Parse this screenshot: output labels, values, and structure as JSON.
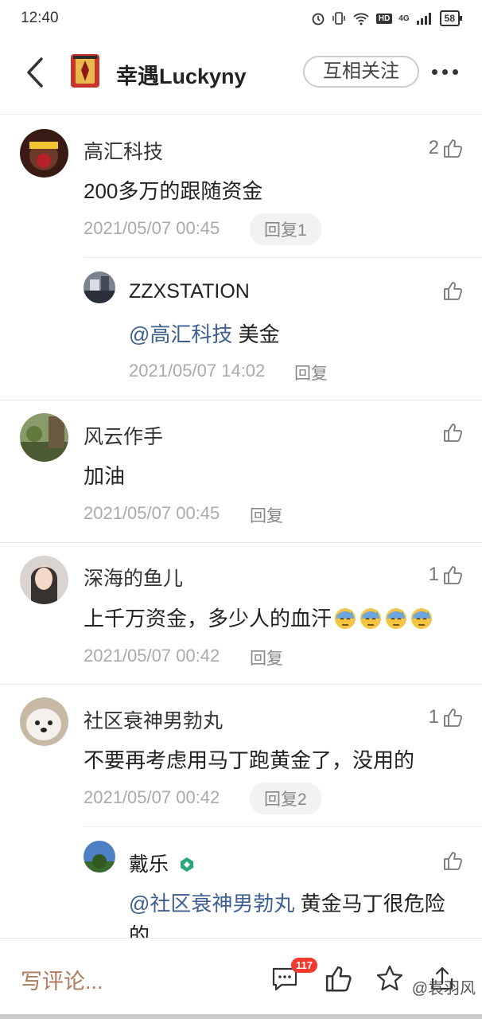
{
  "status_bar": {
    "time": "12:40",
    "network": "4G",
    "hd": "HD",
    "battery": "58"
  },
  "header": {
    "title": "幸遇Luckyny",
    "follow_label": "互相关注"
  },
  "comments": [
    {
      "name": "高汇科技",
      "text": "200多万的跟随资金",
      "time": "2021/05/07 00:45",
      "reply_label": "回复1",
      "likes": "2",
      "replies": [
        {
          "name": "ZZXSTATION",
          "mention": "@高汇科技",
          "text": " 美金",
          "time": "2021/05/07 14:02",
          "reply_label": "回复"
        }
      ]
    },
    {
      "name": "风云作手",
      "text": "加油",
      "time": "2021/05/07 00:45",
      "reply_label": "回复",
      "likes": ""
    },
    {
      "name": "深海的鱼儿",
      "text": "上千万资金，多少人的血汗",
      "emoji_count": 4,
      "time": "2021/05/07 00:42",
      "reply_label": "回复",
      "likes": "1"
    },
    {
      "name": "社区衰神男勃丸",
      "text": "不要再考虑用马丁跑黄金了，没用的",
      "time": "2021/05/07 00:42",
      "reply_label": "回复2",
      "likes": "1",
      "replies": [
        {
          "name": "戴乐",
          "mention": "@社区衰神男勃丸",
          "text": " 黄金马丁很危险",
          "text_line2": "的",
          "time": "",
          "reply_label": ""
        }
      ]
    }
  ],
  "bottom_bar": {
    "write_placeholder": "写评论...",
    "comment_count": "117",
    "watermark": "@袁羽风"
  },
  "colors": {
    "mention": "#3d5f91",
    "badge": "#f43a2f",
    "write_comment": "#b07a5a",
    "verified": "#2aa776"
  }
}
